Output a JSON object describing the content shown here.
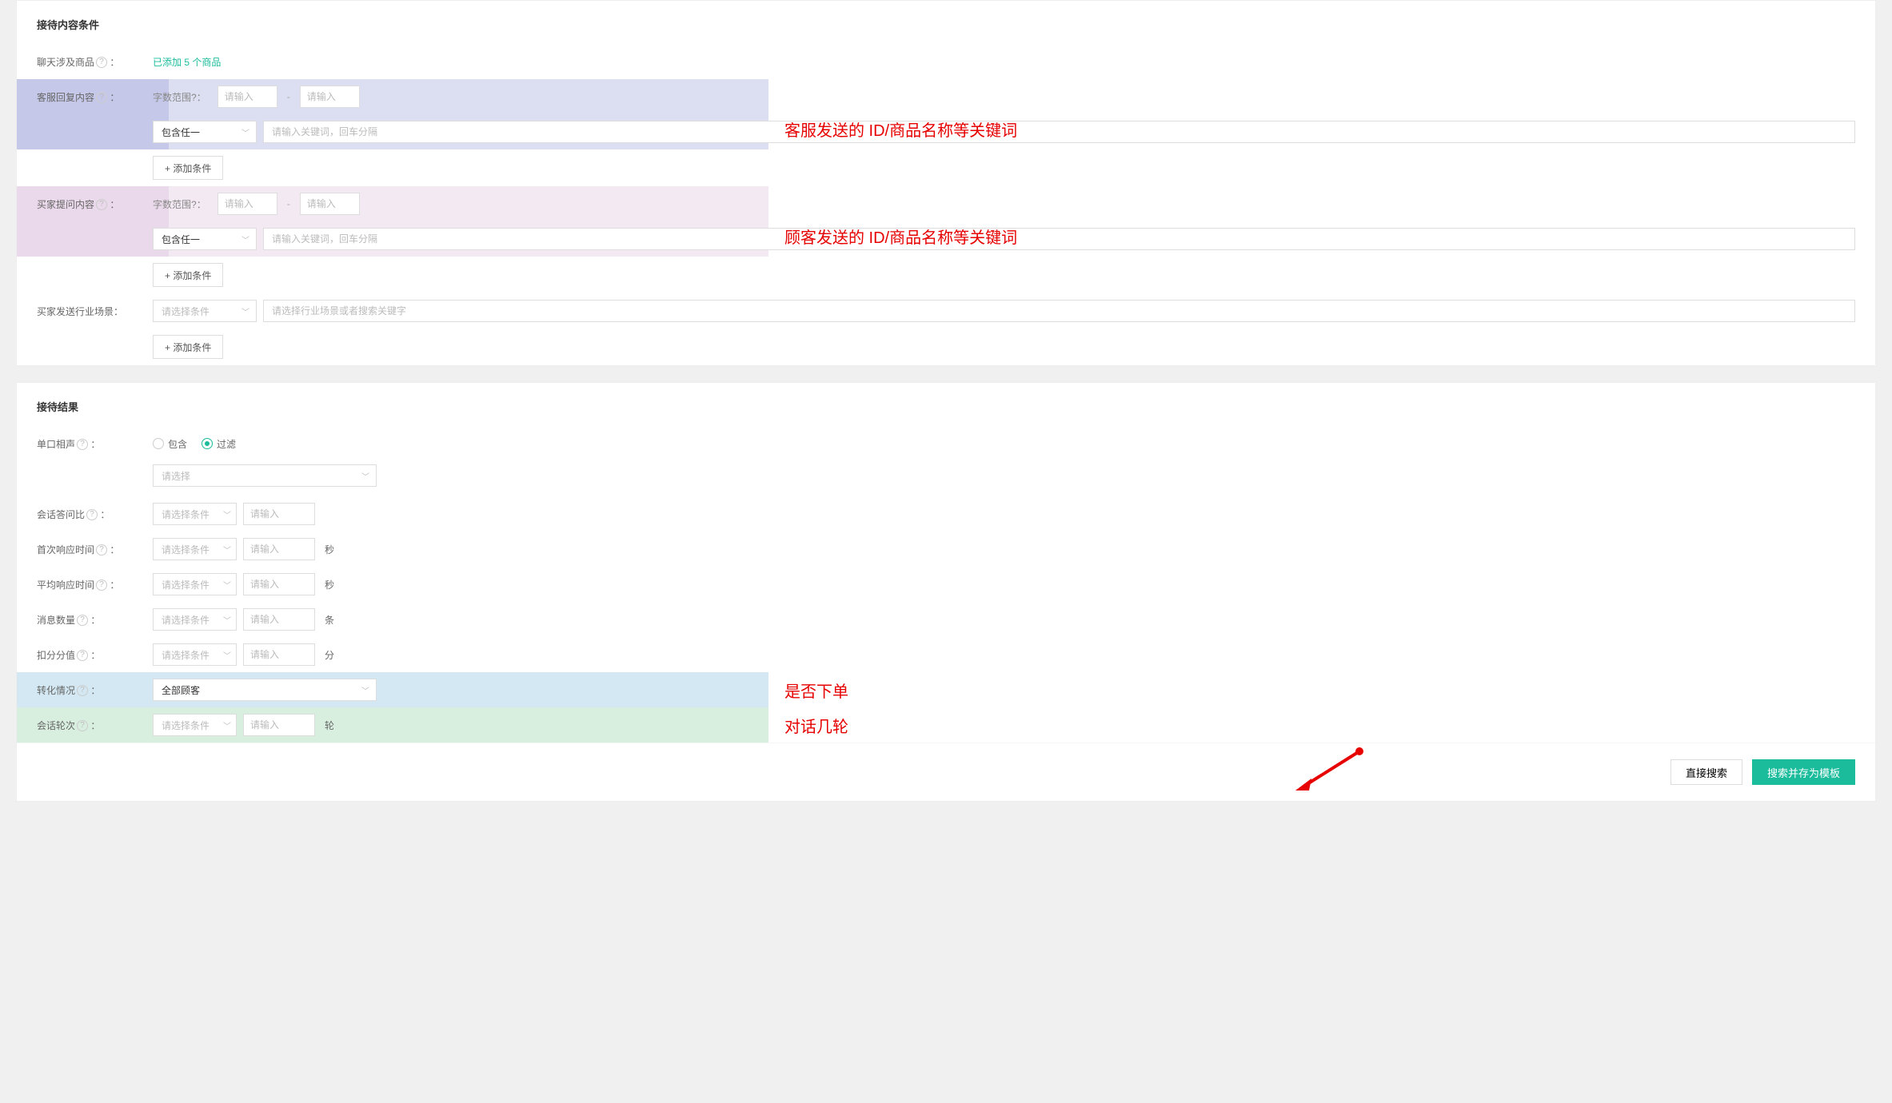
{
  "section1": {
    "title": "接待内容条件",
    "chat_products": {
      "label": "聊天涉及商品",
      "link": "已添加 5 个商品"
    },
    "cs_reply": {
      "label": "客服回复内容",
      "wordrange_label": "字数范围",
      "min_ph": "请输入",
      "max_ph": "请输入",
      "contain_select": "包含任一",
      "keyword_ph": "请输入关键词，回车分隔",
      "add_btn": "+  添加条件",
      "annot": "客服发送的 ID/商品名称等关键词"
    },
    "buyer_q": {
      "label": "买家提问内容",
      "wordrange_label": "字数范围",
      "min_ph": "请输入",
      "max_ph": "请输入",
      "contain_select": "包含任一",
      "keyword_ph": "请输入关键词，回车分隔",
      "add_btn": "+  添加条件",
      "annot": "顾客发送的 ID/商品名称等关键词"
    },
    "buyer_scene": {
      "label": "买家发送行业场景",
      "cond_ph": "请选择条件",
      "input_ph": "请选择行业场景或者搜索关键字",
      "add_btn": "+  添加条件"
    }
  },
  "section2": {
    "title": "接待结果",
    "danko": {
      "label": "单口相声",
      "opt1": "包含",
      "opt2": "过滤",
      "select_ph": "请选择"
    },
    "answer_ratio": {
      "label": "会话答问比",
      "cond_ph": "请选择条件",
      "input_ph": "请输入"
    },
    "first_resp": {
      "label": "首次响应时间",
      "cond_ph": "请选择条件",
      "input_ph": "请输入",
      "unit": "秒"
    },
    "avg_resp": {
      "label": "平均响应时间",
      "cond_ph": "请选择条件",
      "input_ph": "请输入",
      "unit": "秒"
    },
    "msg_count": {
      "label": "消息数量",
      "cond_ph": "请选择条件",
      "input_ph": "请输入",
      "unit": "条"
    },
    "deduct": {
      "label": "扣分分值",
      "cond_ph": "请选择条件",
      "input_ph": "请输入",
      "unit": "分"
    },
    "convert": {
      "label": "转化情况",
      "value": "全部顾客",
      "annot": "是否下单"
    },
    "rounds": {
      "label": "会话轮次",
      "cond_ph": "请选择条件",
      "input_ph": "请输入",
      "unit": "轮",
      "annot": "对话几轮"
    }
  },
  "footer": {
    "btn1": "直接搜索",
    "btn2": "搜索并存为模板"
  }
}
